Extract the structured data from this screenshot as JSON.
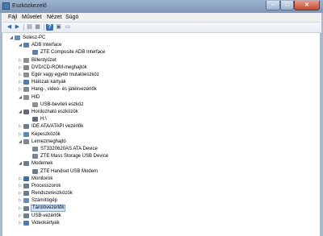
{
  "window": {
    "title": "Eszközkezelő",
    "controls": {
      "minimize": "–",
      "maximize": "□",
      "close": "✕"
    }
  },
  "menu": {
    "items": [
      "Fájl",
      "Művelet",
      "Nézet",
      "Súgó"
    ]
  },
  "toolbar": {
    "buttons": [
      {
        "icon": "back-arrow-icon",
        "glyph": "◀"
      },
      {
        "icon": "forward-arrow-icon",
        "glyph": "▶"
      },
      {
        "icon": "properties-icon",
        "glyph": "▤"
      },
      {
        "icon": "device-list-icon",
        "glyph": "▦"
      },
      {
        "icon": "help-icon",
        "glyph": "?"
      },
      {
        "icon": "view-icon",
        "glyph": "▣"
      },
      {
        "icon": "monitor-icon",
        "glyph": "▭"
      }
    ]
  },
  "tree": [
    {
      "label": "Solesz-PC",
      "level": 0,
      "expander": "◢",
      "icon": "computer-icon",
      "color": "#6b8db5"
    },
    {
      "label": "ADB Interface",
      "level": 1,
      "expander": "◢",
      "icon": "adb-icon",
      "color": "#5a7fa8"
    },
    {
      "label": "ZTE Composite ADB Interface",
      "level": 2,
      "expander": "",
      "icon": "adb-device-icon",
      "color": "#5a7fa8"
    },
    {
      "label": "Billentyűzet",
      "level": 1,
      "expander": "▷",
      "icon": "keyboard-icon",
      "color": "#8a8f96"
    },
    {
      "label": "DVD/CD-ROM-meghajtók",
      "level": 1,
      "expander": "▷",
      "icon": "dvd-drive-icon",
      "color": "#7d8590"
    },
    {
      "label": "Egér vagy egyéb mutatóeszköz",
      "level": 1,
      "expander": "▷",
      "icon": "mouse-icon",
      "color": "#8a8f96"
    },
    {
      "label": "Hálózati kártyák",
      "level": 1,
      "expander": "▷",
      "icon": "network-adapter-icon",
      "color": "#4c7bb0"
    },
    {
      "label": "Hang-, videó- és játékvezérlők",
      "level": 1,
      "expander": "▷",
      "icon": "sound-icon",
      "color": "#7a8a9a"
    },
    {
      "label": "HID",
      "level": 1,
      "expander": "◢",
      "icon": "hid-icon",
      "color": "#8a8f96"
    },
    {
      "label": "USB-beviteli eszköz",
      "level": 2,
      "expander": "",
      "icon": "usb-input-icon",
      "color": "#8a8f96"
    },
    {
      "label": "Hordozható eszközök",
      "level": 1,
      "expander": "◢",
      "icon": "portable-device-icon",
      "color": "#5f6b7a"
    },
    {
      "label": "H:\\",
      "level": 2,
      "expander": "",
      "icon": "drive-icon",
      "color": "#5f6b7a"
    },
    {
      "label": "IDE ATA/ATAPI vezérlők",
      "level": 1,
      "expander": "▷",
      "icon": "ide-controller-icon",
      "color": "#6e7c8c"
    },
    {
      "label": "Képeszközök",
      "level": 1,
      "expander": "▷",
      "icon": "imaging-device-icon",
      "color": "#5a8ab8"
    },
    {
      "label": "Lemezmeghajtó",
      "level": 1,
      "expander": "◢",
      "icon": "disk-drive-icon",
      "color": "#7d8590"
    },
    {
      "label": "ST3320620AS ATA Device",
      "level": 2,
      "expander": "",
      "icon": "hard-disk-icon",
      "color": "#7d8590"
    },
    {
      "label": "ZTE Mass Storage USB Device",
      "level": 2,
      "expander": "",
      "icon": "usb-storage-icon",
      "color": "#7d8590"
    },
    {
      "label": "Modemek",
      "level": 1,
      "expander": "◢",
      "icon": "modem-icon",
      "color": "#6e7c8c"
    },
    {
      "label": "ZTE Handset USB Modem",
      "level": 2,
      "expander": "",
      "icon": "usb-modem-icon",
      "color": "#6e7c8c"
    },
    {
      "label": "Monitorok",
      "level": 1,
      "expander": "▷",
      "icon": "monitor-icon",
      "color": "#3f6fa5"
    },
    {
      "label": "Processzorok",
      "level": 1,
      "expander": "▷",
      "icon": "processor-icon",
      "color": "#6e7c8c"
    },
    {
      "label": "Rendszereszközök",
      "level": 1,
      "expander": "▷",
      "icon": "system-devices-icon",
      "color": "#6e7c8c"
    },
    {
      "label": "Számítógép",
      "level": 1,
      "expander": "▷",
      "icon": "computer-icon",
      "color": "#6b8db5"
    },
    {
      "label": "Tárolóvezérlők",
      "level": 1,
      "expander": "▷",
      "icon": "storage-controller-icon",
      "color": "#6e7c8c",
      "selected": true
    },
    {
      "label": "USB-vezérlők",
      "level": 1,
      "expander": "▷",
      "icon": "usb-controller-icon",
      "color": "#6e7c8c"
    },
    {
      "label": "Videokártyák",
      "level": 1,
      "expander": "▷",
      "icon": "display-adapter-icon",
      "color": "#4c7bb0"
    }
  ]
}
